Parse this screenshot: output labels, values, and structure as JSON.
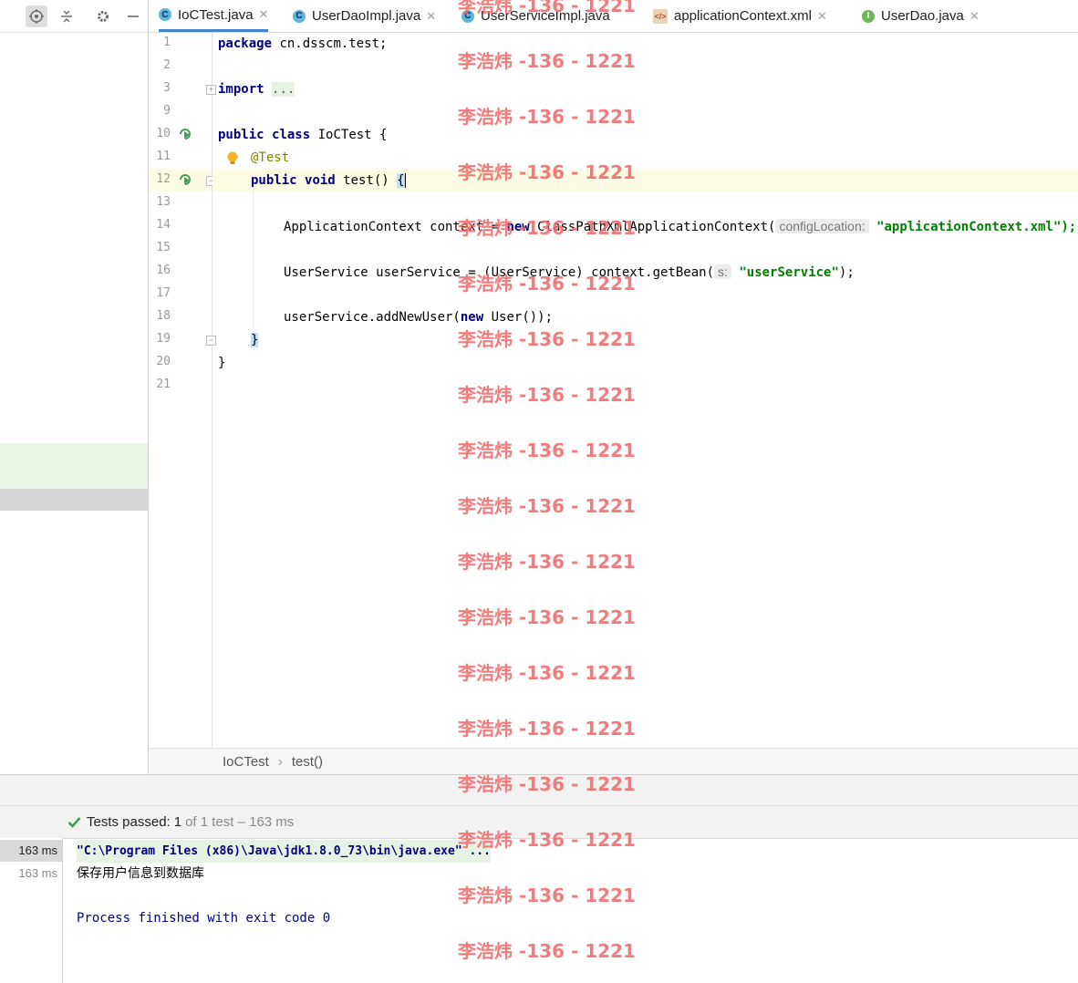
{
  "tabs": [
    {
      "label": "IoCTest.java",
      "type": "class",
      "active": true
    },
    {
      "label": "UserDaoImpl.java",
      "type": "class",
      "active": false
    },
    {
      "label": "UserServiceImpl.java",
      "type": "class",
      "active": false
    },
    {
      "label": "applicationContext.xml",
      "type": "xml",
      "active": false
    },
    {
      "label": "UserDao.java",
      "type": "interface",
      "active": false
    }
  ],
  "tab_icon_letters": {
    "class": "C",
    "interface": "I",
    "xml": "</>"
  },
  "line_numbers": [
    "1",
    "2",
    "3",
    "9",
    "10",
    "11",
    "12",
    "13",
    "14",
    "15",
    "16",
    "17",
    "18",
    "19",
    "20",
    "21"
  ],
  "code": {
    "l1": {
      "kw": "package",
      "rest": " cn.dsscm.test;"
    },
    "l3": {
      "kw": "import",
      "fold": "..."
    },
    "l10": {
      "kw1": "public",
      "kw2": "class",
      "rest": " IoCTest {"
    },
    "l11": {
      "ann": "@Test"
    },
    "l12": {
      "kw1": "public",
      "kw2": "void",
      "rest": " test() ",
      "brace": "{"
    },
    "l14": {
      "pre": "ApplicationContext context = ",
      "kw": "new",
      "mid": " ClassPathXmlApplicationContext(",
      "hint": "configLocation:",
      "str": "\"applicationContext.xml\");"
    },
    "l16": {
      "pre": "UserService userService = (UserService) context.getBean(",
      "hint": "s:",
      "str": "\"userService\"",
      "post": ");"
    },
    "l18": {
      "pre": "userService.addNewUser(",
      "kw": "new",
      "post": " User());"
    },
    "l19": {
      "brace": "}"
    },
    "l20": {
      "rest": "}"
    }
  },
  "breadcrumb": {
    "class": "IoCTest",
    "separator": "›",
    "method": "test()"
  },
  "test_status": {
    "prefix": "Tests passed:",
    "passed": "1",
    "suffix": "of 1 test – 163 ms"
  },
  "results_times": [
    "163 ms",
    "163 ms"
  ],
  "console": {
    "command": "\"C:\\Program Files (x86)\\Java\\jdk1.8.0_73\\bin\\java.exe\" ...",
    "output": "保存用户信息到数据库",
    "exit": "Process finished with exit code 0"
  },
  "watermark": "李浩炜 -136 - 1221",
  "colors": {
    "keyword": "#000080",
    "string": "#008000",
    "annotation": "#808000",
    "watermark": "#f16a6a",
    "pass": "#3f9e4d"
  }
}
